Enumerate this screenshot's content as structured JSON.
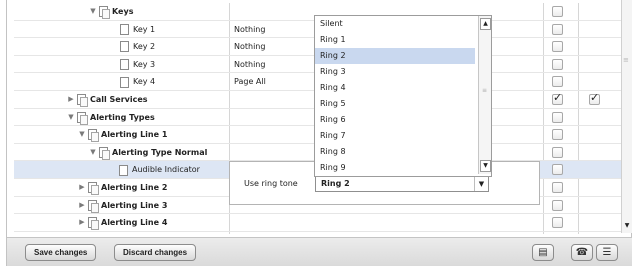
{
  "tree": {
    "rows": [
      {
        "label": "Keys",
        "value": "",
        "bold": true,
        "toggle": "▼",
        "cb1": false,
        "cb2": null
      },
      {
        "label": "Key 1",
        "value": "Nothing",
        "bold": false,
        "toggle": "",
        "cb1": false,
        "cb2": null
      },
      {
        "label": "Key 2",
        "value": "Nothing",
        "bold": false,
        "toggle": "",
        "cb1": false,
        "cb2": null
      },
      {
        "label": "Key 3",
        "value": "Nothing",
        "bold": false,
        "toggle": "",
        "cb1": false,
        "cb2": null
      },
      {
        "label": "Key 4",
        "value": "Page All",
        "bold": false,
        "toggle": "",
        "cb1": false,
        "cb2": null
      },
      {
        "label": "Call Services",
        "value": "",
        "bold": true,
        "toggle": "▶",
        "cb1": true,
        "cb2": true
      },
      {
        "label": "Alerting Types",
        "value": "",
        "bold": true,
        "toggle": "▼",
        "cb1": false,
        "cb2": null
      },
      {
        "label": "Alerting Line 1",
        "value": "",
        "bold": true,
        "toggle": "▼",
        "cb1": false,
        "cb2": null
      },
      {
        "label": "Alerting Type Normal",
        "value": "",
        "bold": true,
        "toggle": "▼",
        "cb1": false,
        "cb2": null
      },
      {
        "label": "Audible Indicator",
        "value": "",
        "bold": false,
        "toggle": "",
        "cb1": false,
        "cb2": null
      },
      {
        "label": "Alerting Line 2",
        "value": "",
        "bold": true,
        "toggle": "▶",
        "cb1": false,
        "cb2": null
      },
      {
        "label": "Alerting Line 3",
        "value": "",
        "bold": true,
        "toggle": "▶",
        "cb1": false,
        "cb2": null
      },
      {
        "label": "Alerting Line 4",
        "value": "",
        "bold": true,
        "toggle": "▶",
        "cb1": false,
        "cb2": null
      }
    ]
  },
  "dropdown": {
    "options": [
      "Silent",
      "Ring 1",
      "Ring 2",
      "Ring 3",
      "Ring 4",
      "Ring 5",
      "Ring 6",
      "Ring 7",
      "Ring 8",
      "Ring 9"
    ],
    "highlighted": "Ring 2"
  },
  "editor": {
    "label": "Use ring tone",
    "selected": "Ring 2"
  },
  "footer": {
    "save_label": "Save changes",
    "discard_label": "Discard changes",
    "icons": [
      "printer-icon",
      "phone-icon",
      "list-icon"
    ]
  },
  "colors": {
    "selected_row": "#dde6f4",
    "highlighted_option": "#c9d8ef"
  }
}
